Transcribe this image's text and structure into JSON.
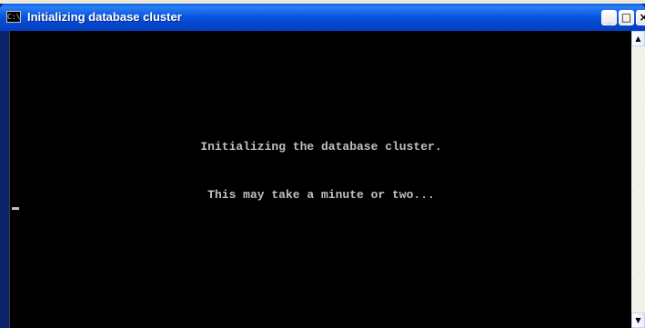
{
  "window": {
    "title": "Initializing database cluster",
    "app_icon": "console-icon",
    "app_icon_glyph": "C:\\",
    "controls": {
      "minimize_glyph": "_",
      "maximize_glyph": "□",
      "close_glyph": "×"
    }
  },
  "console": {
    "lines": [
      "Initializing the database cluster.",
      "This may take a minute or two..."
    ],
    "text_color": "#c0c0c0",
    "background_color": "#000000"
  },
  "scrollbar": {
    "up_glyph": "▲",
    "down_glyph": "▼"
  },
  "colors": {
    "titlebar": "#0a58e0",
    "title_text": "#ffffff"
  }
}
